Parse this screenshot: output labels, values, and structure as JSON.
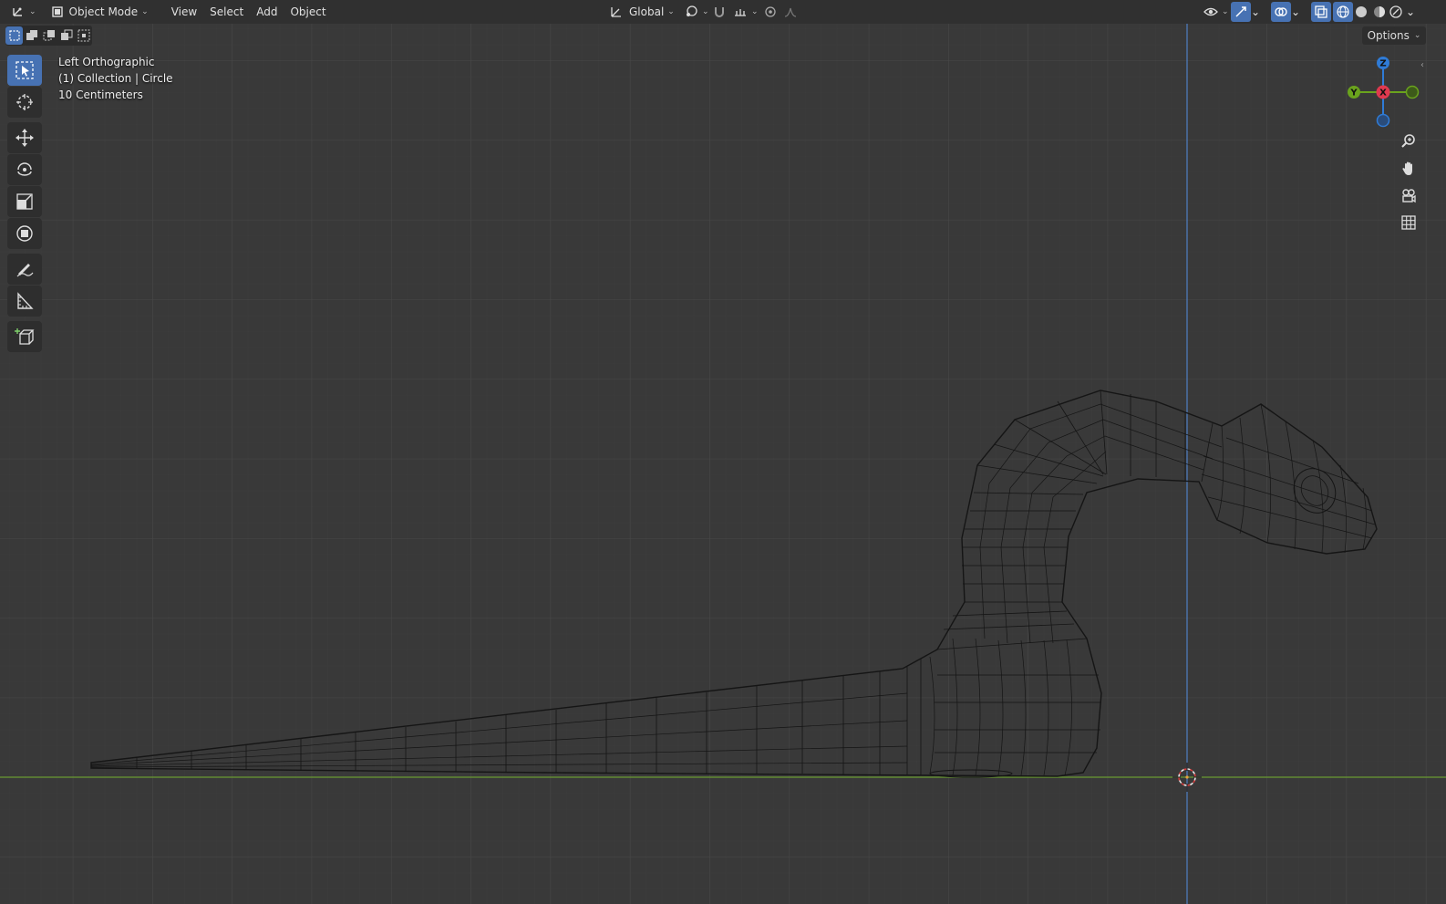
{
  "header": {
    "editor_type_icon": "3d-viewport-icon",
    "mode_label": "Object Mode",
    "menus": [
      "View",
      "Select",
      "Add",
      "Object"
    ],
    "transform_orientation": "Global",
    "pivot_icon": "pivot-point-icon",
    "snap_icon": "snap-magnet-icon",
    "proportional_icon": "proportional-edit-icon"
  },
  "viewport": {
    "view_name": "Left Orthographic",
    "collection_info": "(1) Collection | Circle",
    "grid_scale": "10 Centimeters",
    "options_label": "Options"
  },
  "gizmo": {
    "z_label": "Z",
    "y_label": "Y",
    "x_label": "X",
    "colors": {
      "z": "#2f7bd6",
      "y": "#6aa31d",
      "x": "#e0394f"
    }
  },
  "toolbar": {
    "tools": [
      "select-box",
      "cursor",
      "move",
      "rotate",
      "scale",
      "transform",
      "annotate",
      "measure",
      "add-cube"
    ]
  },
  "colors": {
    "accent": "#4772b3",
    "background": "#393939",
    "grid": "#454545",
    "y_axis_line": "#5a88c9",
    "floor_line": "#6f9a3a",
    "wire": "#111111"
  }
}
